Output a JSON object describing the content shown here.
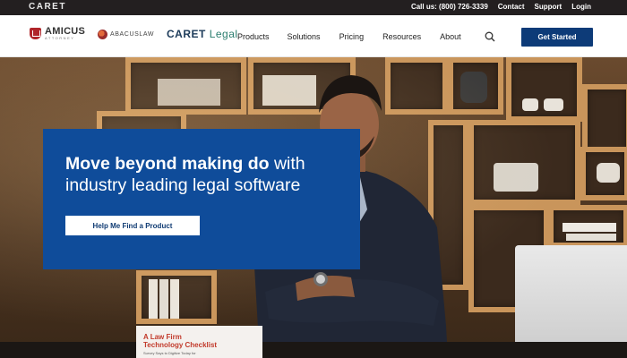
{
  "topbar": {
    "brand": "CARET",
    "links": [
      "Call us: (800) 726-3339",
      "Contact",
      "Support",
      "Login"
    ]
  },
  "nav": {
    "logos": {
      "amicus_top": "AMICUS",
      "amicus_bottom": "ATTORNEY",
      "abacus": "ABACUSLAW",
      "caret_prefix": "CARET",
      "caret_suffix": "Legal"
    },
    "menu": [
      "Products",
      "Solutions",
      "Pricing",
      "Resources",
      "About"
    ],
    "cta": "Get Started"
  },
  "hero": {
    "title_bold": "Move beyond making do",
    "title_rest_1": " with",
    "title_line2": "industry leading legal software",
    "button": "Help Me Find a Product"
  },
  "doc": {
    "title_line1": "A Law Firm",
    "title_line2": "Technology Checklist",
    "subtitle": "Survey Says to Digitize Today for"
  },
  "colors": {
    "topbar": "#231f20",
    "accent": "#0d3b78",
    "hero_card": "#0f4c9a"
  }
}
